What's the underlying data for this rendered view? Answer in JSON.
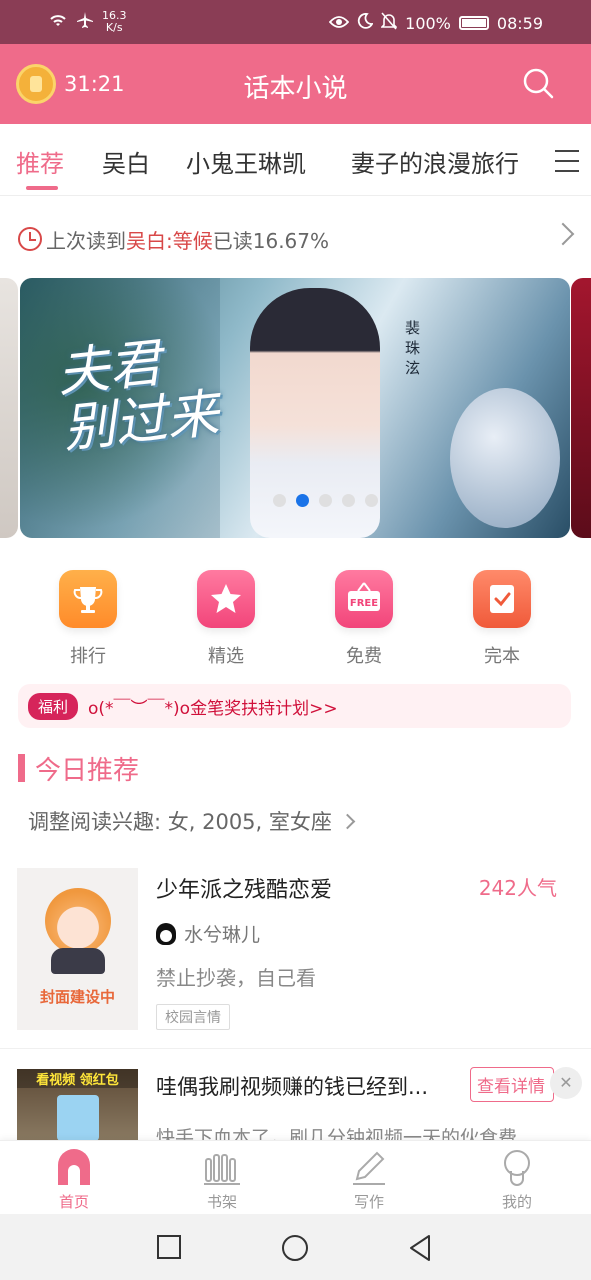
{
  "status_bar": {
    "net_speed_value": "16.3",
    "net_speed_unit": "K/s",
    "battery": "100%",
    "time": "08:59"
  },
  "header": {
    "timer": "31:21",
    "title": "话本小说"
  },
  "tabs": [
    {
      "label": "推荐",
      "active": true
    },
    {
      "label": "吴白",
      "active": false
    },
    {
      "label": "小鬼王琳凯",
      "active": false
    },
    {
      "label": "妻子的浪漫旅行",
      "active": false
    }
  ],
  "last_read": {
    "prefix": "上次读到",
    "book": "吴白:",
    "chapter": "等候",
    "progress": "已读16.67%"
  },
  "banner": {
    "title_line1": "夫君",
    "title_line2": "别过来",
    "vertical_text": "裴珠泫",
    "active_slide": 2,
    "slide_count": 5
  },
  "quick_links": [
    {
      "label": "排行",
      "icon": "trophy-icon"
    },
    {
      "label": "精选",
      "icon": "star-icon"
    },
    {
      "label": "免费",
      "icon": "free-tag-icon"
    },
    {
      "label": "完本",
      "icon": "checked-book-icon"
    }
  ],
  "welfare": {
    "badge": "福利",
    "text": "o(*￣︶￣*)o金笔奖扶持计划>>"
  },
  "section": {
    "title": "今日推荐",
    "interest": "调整阅读兴趣: 女, 2005, 室女座"
  },
  "book": {
    "title": "少年派之残酷恋爱",
    "popularity": "242人气",
    "author": "水兮琳儿",
    "description": "禁止抄袭，自己看",
    "tag": "校园言情",
    "cover_label": "封面建设中"
  },
  "ad": {
    "thumb_text": "看视频 领红包",
    "title": "哇偶我刷视频赚的钱已经到...",
    "detail_button": "查看详情",
    "subtitle": "快手下血本了，刷几分钟视频一天的伙食费"
  },
  "bottom_nav": [
    {
      "label": "首页",
      "active": true
    },
    {
      "label": "书架",
      "active": false
    },
    {
      "label": "写作",
      "active": false
    },
    {
      "label": "我的",
      "active": false
    }
  ],
  "colors": {
    "brand_pink": "#ef6b8a",
    "status_bar": "#8a3d55",
    "highlight_red": "#d84848"
  }
}
